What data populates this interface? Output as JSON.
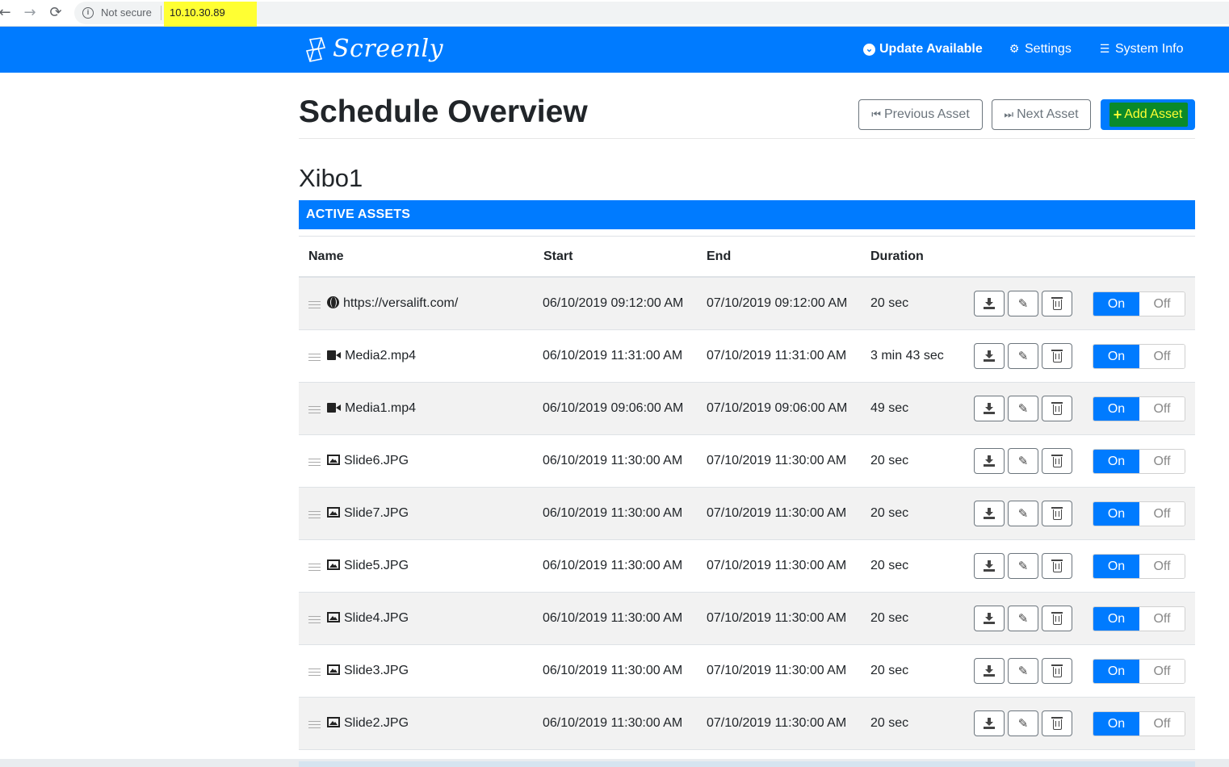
{
  "browser": {
    "back": "←",
    "forward": "→",
    "reload": "⟳",
    "security_label": "Not secure",
    "url": "10.10.30.89"
  },
  "navbar": {
    "brand": "Screenly",
    "links": {
      "update": "Update Available",
      "settings": "Settings",
      "system_info": "System Info"
    }
  },
  "header": {
    "title": "Schedule Overview",
    "previous_asset": "Previous Asset",
    "next_asset": "Next Asset",
    "add_asset": "Add Asset"
  },
  "device": {
    "name": "Xibo1"
  },
  "section": {
    "title": "ACTIVE ASSETS"
  },
  "table": {
    "columns": [
      "Name",
      "Start",
      "End",
      "Duration"
    ],
    "toggle_on": "On",
    "toggle_off": "Off",
    "rows": [
      {
        "type": "web",
        "name": "https://versalift.com/",
        "start": "06/10/2019 09:12:00 AM",
        "end": "07/10/2019 09:12:00 AM",
        "duration": "20 sec"
      },
      {
        "type": "video",
        "name": "Media2.mp4",
        "start": "06/10/2019 11:31:00 AM",
        "end": "07/10/2019 11:31:00 AM",
        "duration": "3 min 43 sec"
      },
      {
        "type": "video",
        "name": "Media1.mp4",
        "start": "06/10/2019 09:06:00 AM",
        "end": "07/10/2019 09:06:00 AM",
        "duration": "49 sec"
      },
      {
        "type": "image",
        "name": "Slide6.JPG",
        "start": "06/10/2019 11:30:00 AM",
        "end": "07/10/2019 11:30:00 AM",
        "duration": "20 sec"
      },
      {
        "type": "image",
        "name": "Slide7.JPG",
        "start": "06/10/2019 11:30:00 AM",
        "end": "07/10/2019 11:30:00 AM",
        "duration": "20 sec"
      },
      {
        "type": "image",
        "name": "Slide5.JPG",
        "start": "06/10/2019 11:30:00 AM",
        "end": "07/10/2019 11:30:00 AM",
        "duration": "20 sec"
      },
      {
        "type": "image",
        "name": "Slide4.JPG",
        "start": "06/10/2019 11:30:00 AM",
        "end": "07/10/2019 11:30:00 AM",
        "duration": "20 sec"
      },
      {
        "type": "image",
        "name": "Slide3.JPG",
        "start": "06/10/2019 11:30:00 AM",
        "end": "07/10/2019 11:30:00 AM",
        "duration": "20 sec"
      },
      {
        "type": "image",
        "name": "Slide2.JPG",
        "start": "06/10/2019 11:30:00 AM",
        "end": "07/10/2019 11:30:00 AM",
        "duration": "20 sec"
      }
    ]
  },
  "colors": {
    "primary": "#007bff",
    "url_highlight": "#ffff33",
    "add_highlight": "#0a8a2a"
  }
}
